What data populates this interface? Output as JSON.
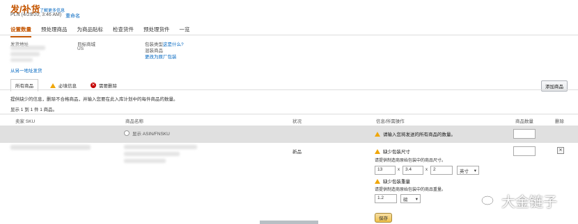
{
  "header": {
    "title": "发/补货",
    "learn_more": "了解更多信息",
    "subtitle": "PLN (4/29/20, 3:46 AM)",
    "rename": "重命名"
  },
  "tabs": [
    "设置数量",
    "预处理商品",
    "为商品贴标",
    "检查货件",
    "预处理货件",
    "一览"
  ],
  "shipment": {
    "from_label": "发货地址",
    "marketplace_label": "目标商城",
    "marketplace_value": "US",
    "packing_label": "包装类型",
    "packing_help": "这是什么?",
    "packing_value": "混装商品",
    "change_packing": "更改为原厂包装",
    "ship_other": "从另一地址发货"
  },
  "filter_tabs": {
    "all": "所有商品",
    "info_needed": "必填信息",
    "remove": "需要删除"
  },
  "add_products": "添加商品",
  "instructions": "提供缺少的信息，删除不合格商品，并输入您要在此入库计划中的每件商品的数量。",
  "count": "显示 1 到 1 件 1 商品。",
  "columns": {
    "seller_sku": "卖家 SKU",
    "product_name": "商品名称",
    "condition": "状况",
    "info_action": "信息/所需操作",
    "units": "商品数量",
    "remove": "删除"
  },
  "grey_row": {
    "show_asin": "显示 ASIN/FNSKU",
    "message": "请输入您将发送的所有商品的数量。"
  },
  "item_row": {
    "condition": "新品",
    "missing_dims_title": "缺少包装尺寸",
    "missing_dims_desc": "请提供制造商原始包装中的商品尺寸。",
    "dim1": "13",
    "dim2": "3.4",
    "dim3": "2",
    "dim_unit": "英寸",
    "missing_weight_title": "缺少包装重量",
    "missing_weight_desc": "请提供制造商原始包装中的商品重量。",
    "weight": "1.2",
    "weight_unit": "磅",
    "save": "保存"
  },
  "watermark": "大金链子"
}
